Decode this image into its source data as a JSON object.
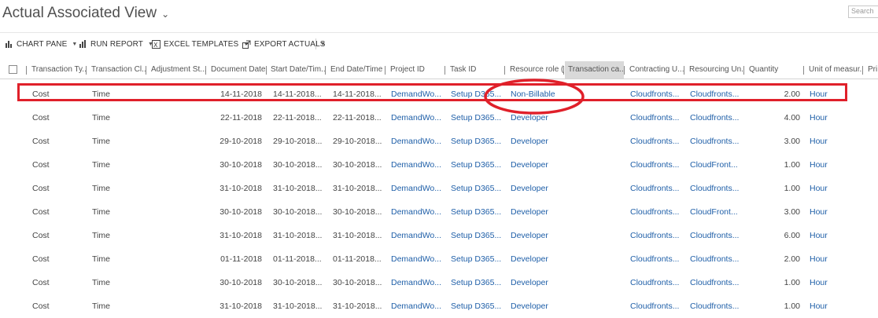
{
  "view": {
    "title": "Actual Associated View"
  },
  "search": {
    "placeholder": "Search"
  },
  "toolbar": {
    "chart_pane": "CHART PANE",
    "run_report": "RUN REPORT",
    "excel_templates": "EXCEL TEMPLATES",
    "export_actuals": "EXPORT ACTUALS"
  },
  "columns": [
    "Transaction Ty...",
    "Transaction Cl...",
    "Adjustment St...",
    "Document Date",
    "Start Date/Tim...",
    "End Date/Time",
    "Project ID",
    "Task ID",
    "Resource role (...",
    "Transaction ca...",
    "Contracting U...",
    "Resourcing Un...",
    "Quantity",
    "Unit of measur...",
    "Pri"
  ],
  "rows": [
    {
      "type": "Cost",
      "class": "Time",
      "doc": "14-11-2018",
      "start": "14-11-2018...",
      "end": "14-11-2018...",
      "project": "DemandWo...",
      "task": "Setup D365...",
      "role": "Non-Billable",
      "contracting": "Cloudfronts...",
      "resourcing": "Cloudfronts...",
      "qty": "2.00",
      "unit": "Hour"
    },
    {
      "type": "Cost",
      "class": "Time",
      "doc": "22-11-2018",
      "start": "22-11-2018...",
      "end": "22-11-2018...",
      "project": "DemandWo...",
      "task": "Setup D365...",
      "role": "Developer",
      "contracting": "Cloudfronts...",
      "resourcing": "Cloudfronts...",
      "qty": "4.00",
      "unit": "Hour"
    },
    {
      "type": "Cost",
      "class": "Time",
      "doc": "29-10-2018",
      "start": "29-10-2018...",
      "end": "29-10-2018...",
      "project": "DemandWo...",
      "task": "Setup D365...",
      "role": "Developer",
      "contracting": "Cloudfronts...",
      "resourcing": "Cloudfronts...",
      "qty": "3.00",
      "unit": "Hour"
    },
    {
      "type": "Cost",
      "class": "Time",
      "doc": "30-10-2018",
      "start": "30-10-2018...",
      "end": "30-10-2018...",
      "project": "DemandWo...",
      "task": "Setup D365...",
      "role": "Developer",
      "contracting": "Cloudfronts...",
      "resourcing": "CloudFront...",
      "qty": "1.00",
      "unit": "Hour"
    },
    {
      "type": "Cost",
      "class": "Time",
      "doc": "31-10-2018",
      "start": "31-10-2018...",
      "end": "31-10-2018...",
      "project": "DemandWo...",
      "task": "Setup D365...",
      "role": "Developer",
      "contracting": "Cloudfronts...",
      "resourcing": "Cloudfronts...",
      "qty": "1.00",
      "unit": "Hour"
    },
    {
      "type": "Cost",
      "class": "Time",
      "doc": "30-10-2018",
      "start": "30-10-2018...",
      "end": "30-10-2018...",
      "project": "DemandWo...",
      "task": "Setup D365...",
      "role": "Developer",
      "contracting": "Cloudfronts...",
      "resourcing": "CloudFront...",
      "qty": "3.00",
      "unit": "Hour"
    },
    {
      "type": "Cost",
      "class": "Time",
      "doc": "31-10-2018",
      "start": "31-10-2018...",
      "end": "31-10-2018...",
      "project": "DemandWo...",
      "task": "Setup D365...",
      "role": "Developer",
      "contracting": "Cloudfronts...",
      "resourcing": "Cloudfronts...",
      "qty": "6.00",
      "unit": "Hour"
    },
    {
      "type": "Cost",
      "class": "Time",
      "doc": "01-11-2018",
      "start": "01-11-2018...",
      "end": "01-11-2018...",
      "project": "DemandWo...",
      "task": "Setup D365...",
      "role": "Developer",
      "contracting": "Cloudfronts...",
      "resourcing": "Cloudfronts...",
      "qty": "2.00",
      "unit": "Hour"
    },
    {
      "type": "Cost",
      "class": "Time",
      "doc": "30-10-2018",
      "start": "30-10-2018...",
      "end": "30-10-2018...",
      "project": "DemandWo...",
      "task": "Setup D365...",
      "role": "Developer",
      "contracting": "Cloudfronts...",
      "resourcing": "Cloudfronts...",
      "qty": "1.00",
      "unit": "Hour"
    },
    {
      "type": "Cost",
      "class": "Time",
      "doc": "31-10-2018",
      "start": "31-10-2018...",
      "end": "31-10-2018...",
      "project": "DemandWo...",
      "task": "Setup D365...",
      "role": "Developer",
      "contracting": "Cloudfronts...",
      "resourcing": "Cloudfronts...",
      "qty": "1.00",
      "unit": "Hour"
    }
  ],
  "colors": {
    "link": "#1f5fa8",
    "annotation": "#e0202a",
    "selected_header": "#d9d9d9"
  }
}
